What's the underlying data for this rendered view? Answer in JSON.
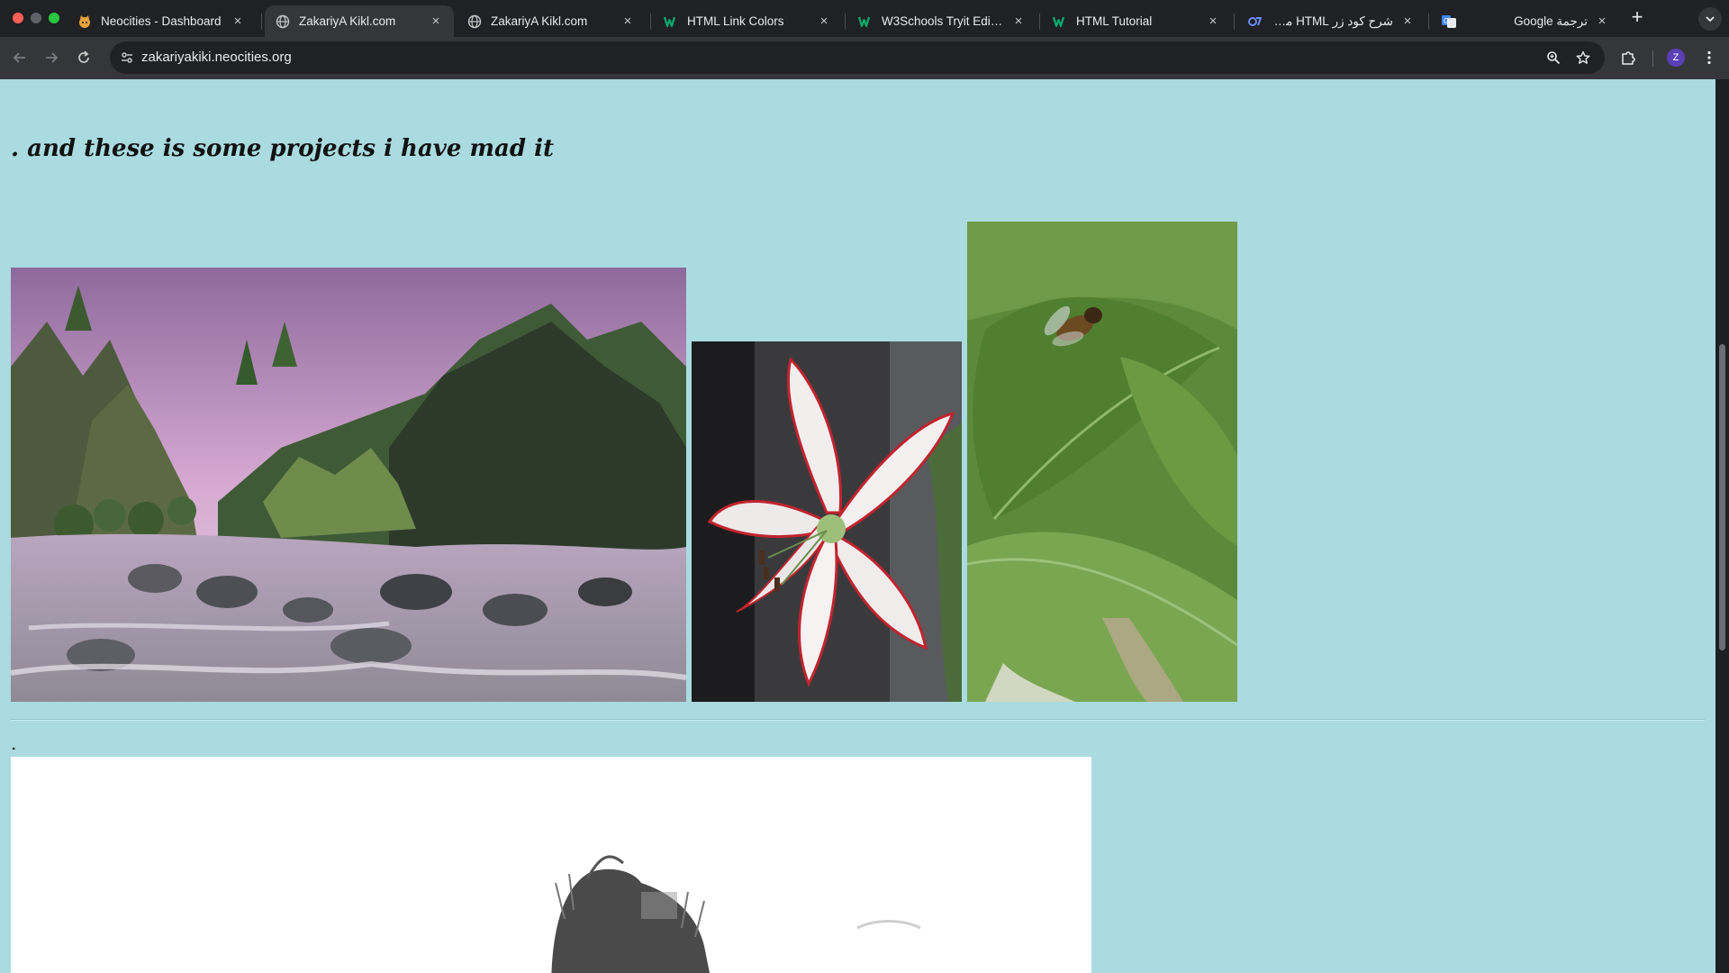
{
  "tabs": [
    {
      "title": "Neocities - Dashboard",
      "icon": "neocities-cat-icon",
      "active": false
    },
    {
      "title": "ZakariyA Kikl.com",
      "icon": "globe-icon",
      "active": true
    },
    {
      "title": "ZakariyA Kikl.com",
      "icon": "globe-icon",
      "active": false
    },
    {
      "title": "HTML Link Colors",
      "icon": "w3schools-icon",
      "active": false
    },
    {
      "title": "W3Schools Tryit Editor",
      "icon": "w3schools-icon",
      "active": false
    },
    {
      "title": "HTML Tutorial",
      "icon": "w3schools-icon",
      "active": false
    },
    {
      "title": "شرح كود زر HTML مع توجيه",
      "icon": "search-favicon-icon",
      "active": false
    },
    {
      "title": "ترجمة Google",
      "icon": "google-translate-icon",
      "active": false
    }
  ],
  "toolbar": {
    "url": "zakariyakiki.neocities.org",
    "avatar_letter": "Z"
  },
  "page": {
    "heading": ". and these is some projects i have mad it",
    "separator_dot": "."
  },
  "colors": {
    "page_background": "#a9dbe0",
    "chrome_dark": "#202124",
    "chrome_toolbar": "#35363a"
  }
}
